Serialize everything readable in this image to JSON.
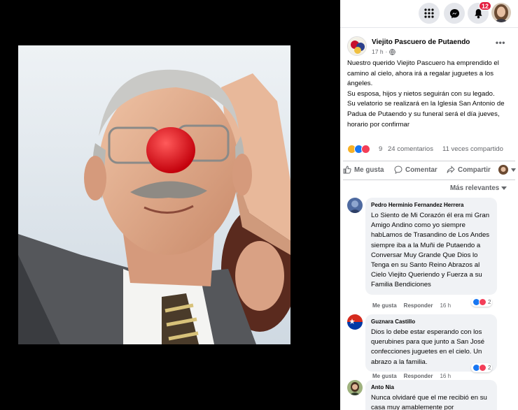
{
  "topbar": {
    "menu_icon": "grid-menu-icon",
    "messenger_icon": "messenger-icon",
    "notifications_icon": "bell-icon",
    "notifications_badge": "12",
    "colors": {
      "badge": "#e41e3f",
      "circle": "#e4e6eb"
    }
  },
  "post": {
    "page_name": "Viejito Pascuero de Putaendo",
    "time": "17 h",
    "audience_icon": "globe-icon",
    "more_icon": "more-dots-icon",
    "paragraphs": [
      "Nuestro querido Viejito Pascuero ha emprendido el camino al cielo, ahora irá a regalar juguetes a los ángeles.",
      "Su esposa, hijos y nietos seguirán con su legado.",
      "Su velatorio se realizará en la Iglesia San Antonio de Padua de Putaendo y su funeral será el día jueves, horario por confirmar"
    ],
    "reactions_count": "9",
    "comments_count": "24 comentarios",
    "shares_count": "11 veces compartido"
  },
  "actions": {
    "like": "Me gusta",
    "comment": "Comentar",
    "share": "Compartir"
  },
  "sort_label": "Más relevantes",
  "comments": [
    {
      "author": "Pedro Herminio Fernandez Herrera",
      "text": "Lo Siento de Mi Corazón él era mi Gran Amigo Andino como yo siempre habLamos de Trasandino de Los Andes siempre iba a la Muñi de Putaendo a Conversar Muy Grande Que Dios lo Tenga en su Santo Reino Abrazos al Cielo Viejito Queriendo y Fuerza a su Familia Bendiciones",
      "like": "Me gusta",
      "reply": "Responder",
      "time": "16 h",
      "reactions": "2"
    },
    {
      "author": "Guznara Castillo",
      "text": "Dios lo debe estar esperando con los querubines para que junto a San José confecciones juguetes en el cielo. Un abrazo a la familia.",
      "like": "Me gusta",
      "reply": "Responder",
      "time": "16 h",
      "reactions": "2"
    },
    {
      "author": "Anto Nia",
      "text": "Nunca olvidaré que el me recibió en su casa muy amablemente por"
    }
  ]
}
